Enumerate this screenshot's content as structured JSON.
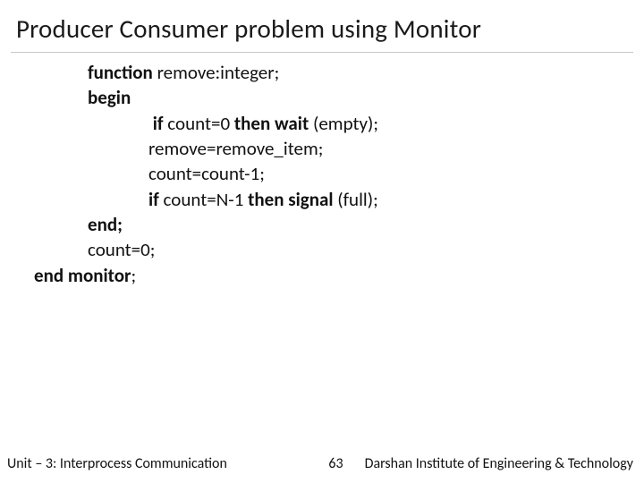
{
  "title": "Producer Consumer problem using Monitor",
  "code": {
    "l1": {
      "b1": "function",
      "t1": " remove:integer;"
    },
    "l2": {
      "b1": "begin"
    },
    "l3": {
      "b1": "if",
      "t1": " count=0 ",
      "b2": "then wait",
      "t2": " (empty);"
    },
    "l4": {
      "t1": "remove=remove_item;"
    },
    "l5": {
      "t1": "count=count-1;"
    },
    "l6": {
      "b1": "if",
      "t1": " count=N-1 ",
      "b2": "then signal",
      "t2": " (full);"
    },
    "l7": {
      "b1": "end;"
    },
    "l8": {
      "t1": "count=0;"
    },
    "l9": {
      "b1": "end monitor",
      "t1": ";"
    }
  },
  "footer": {
    "left": "Unit – 3: Interprocess Communication",
    "page": "63",
    "right": "Darshan Institute of Engineering & Technology"
  }
}
